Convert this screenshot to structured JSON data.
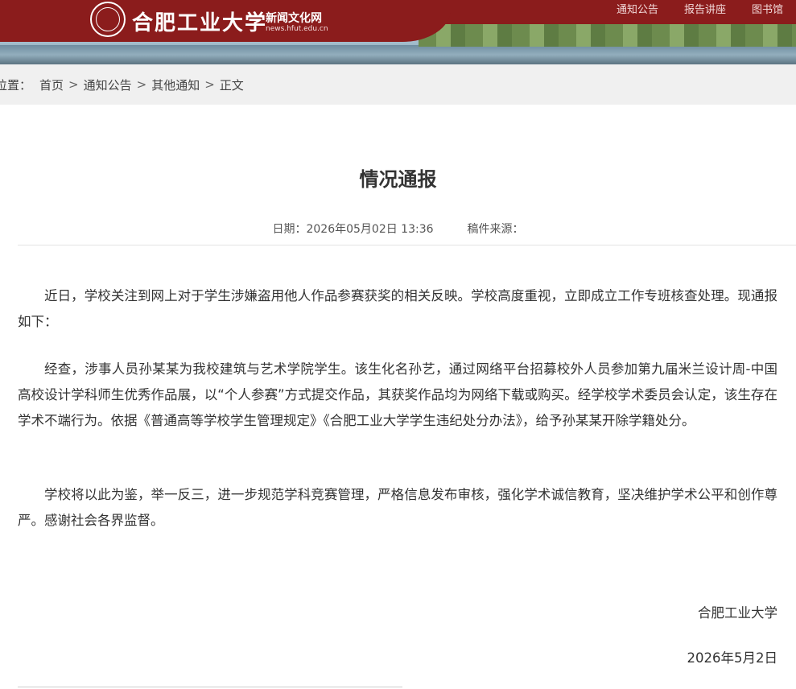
{
  "header": {
    "logo_name": "合肥工业大学",
    "site_name": "新闻文化网",
    "site_url": "news.hfut.edu.cn",
    "nav": [
      "通知公告",
      "报告讲座",
      "图书馆"
    ]
  },
  "breadcrumb": {
    "label": "位置：",
    "items": [
      "首页",
      "通知公告",
      "其他通知",
      "正文"
    ],
    "separator": ">"
  },
  "article": {
    "title": "情况通报",
    "date": "日期：2026年05月02日 13:36",
    "source": "稿件来源：",
    "paragraphs": [
      "近日，学校关注到网上对于学生涉嫌盗用他人作品参赛获奖的相关反映。学校高度重视，立即成立工作专班核查处理。现通报如下：",
      "经查，涉事人员孙某某为我校建筑与艺术学院学生。该生化名孙艺，通过网络平台招募校外人员参加第九届米兰设计周-中国高校设计学科师生优秀作品展，以“个人参赛”方式提交作品，其获奖作品均为网络下载或购买。经学校学术委员会认定，该生存在学术不端行为。依据《普通高等学校学生管理规定》《合肥工业大学学生违纪处分办法》，给予孙某某开除学籍处分。",
      "学校将以此为鉴，举一反三，进一步规范学科竞赛管理，严格信息发布审核，强化学术诚信教育，坚决维护学术公平和创作尊严。感谢社会各界监督。"
    ],
    "signature": "合肥工业大学",
    "sign_date": "2026年5月2日"
  },
  "colors": {
    "brand_red": "#8b1c1c",
    "breadcrumb_bg": "#f0f0f0"
  }
}
